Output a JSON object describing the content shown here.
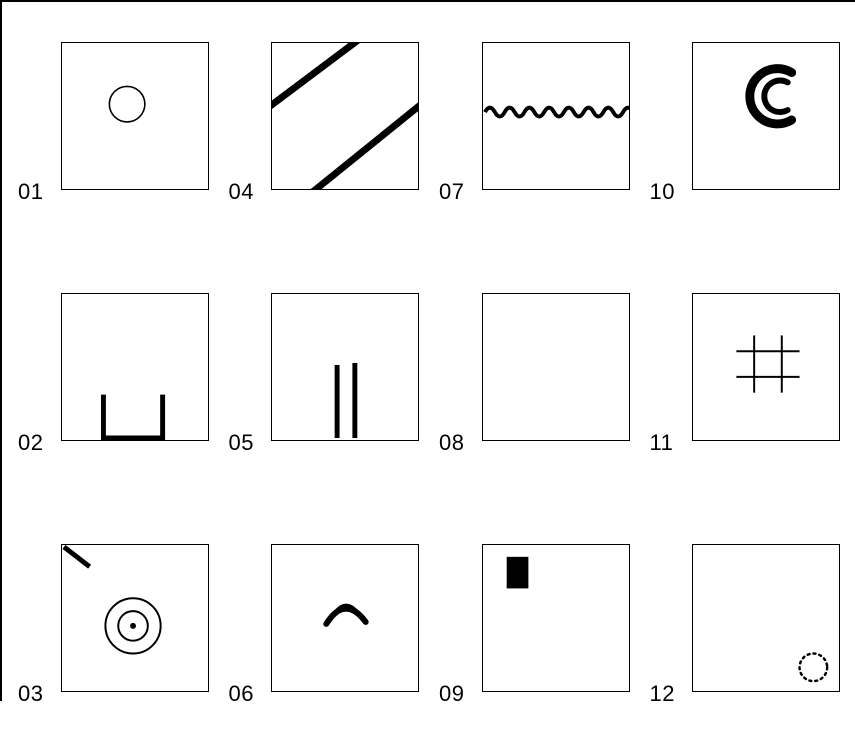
{
  "grid": {
    "rows": 3,
    "cols": 4,
    "cells": [
      {
        "id": "c01",
        "label": "01",
        "shape": "circle",
        "desc": "small hollow circle centered"
      },
      {
        "id": "c04",
        "label": "04",
        "shape": "diagonal-lines",
        "desc": "two thick parallel diagonal lines"
      },
      {
        "id": "c07",
        "label": "07",
        "shape": "zigzag",
        "desc": "horizontal wavy zigzag line"
      },
      {
        "id": "c10",
        "label": "10",
        "shape": "c-double",
        "desc": "thick double-arc capital C"
      },
      {
        "id": "c02",
        "label": "02",
        "shape": "u-square",
        "desc": "partial square open at top, sitting at bottom"
      },
      {
        "id": "c05",
        "label": "05",
        "shape": "two-verticals",
        "desc": "two vertical thick strokes"
      },
      {
        "id": "c08",
        "label": "08",
        "shape": "blank",
        "desc": "empty"
      },
      {
        "id": "c11",
        "label": "11",
        "shape": "hash",
        "desc": "tic-tac-toe grid of thin lines"
      },
      {
        "id": "c03",
        "label": "03",
        "shape": "bullseye-tick",
        "desc": "concentric circles with short tick in top-left corner"
      },
      {
        "id": "c06",
        "label": "06",
        "shape": "crescent",
        "desc": "small filled crescent/arch shape"
      },
      {
        "id": "c09",
        "label": "09",
        "shape": "black-rect",
        "desc": "small solid black rectangle upper-left"
      },
      {
        "id": "c12",
        "label": "12",
        "shape": "dotted-circle",
        "desc": "small dotted circle bottom-right"
      }
    ]
  },
  "shapes": {
    "circle": "<svg viewBox='0 0 148 148'><circle cx='66' cy='62' r='18' fill='none' stroke='#000' stroke-width='1.6'/></svg>",
    "diagonal-lines": "<svg viewBox='0 0 148 148'><line x1='-10' y1='70' x2='110' y2='-20' stroke='#000' stroke-width='7'/><line x1='30' y1='160' x2='160' y2='55' stroke='#000' stroke-width='7'/></svg>",
    "zigzag": "<svg viewBox='0 0 148 148'><path d='M2 70 q5 -9 10 0 q5 9 10 0 q5 -9 10 0 q5 9 10 0 q5 -9 10 0 q5 9 10 0 q5 -9 10 0 q5 9 10 0 q5 -9 10 0 q5 9 10 0 q5 -9 10 0 q5 9 10 0 q5 -9 10 0 q5 9 10 0 q5 -9 10 0' fill='none' stroke='#000' stroke-width='4'/></svg>",
    "c-double": "<svg viewBox='0 0 148 148'><path d='M100 30 A28 28 0 1 0 100 78' fill='none' stroke='#000' stroke-width='9' stroke-linecap='round'/><path d='M96 40 A16 16 0 1 0 96 68' fill='none' stroke='#000' stroke-width='6' stroke-linecap='round'/></svg>",
    "u-square": "<svg viewBox='0 0 148 148'><path d='M42 102 L42 146 L102 146 L102 102' fill='none' stroke='#000' stroke-width='5' stroke-linejoin='miter'/></svg>",
    "two-verticals": "<svg viewBox='0 0 148 148'><line x1='66' y1='72' x2='66' y2='146' stroke='#000' stroke-width='5'/><line x1='84' y1='70' x2='84' y2='146' stroke='#000' stroke-width='5'/></svg>",
    "blank": "<svg viewBox='0 0 148 148'></svg>",
    "hash": "<svg viewBox='0 0 148 148'><line x1='44' y1='58' x2='108' y2='58' stroke='#000' stroke-width='2'/><line x1='44' y1='84' x2='108' y2='84' stroke='#000' stroke-width='2'/><line x1='62' y1='42' x2='62' y2='100' stroke='#000' stroke-width='2'/><line x1='90' y1='42' x2='90' y2='100' stroke='#000' stroke-width='2'/></svg>",
    "bullseye-tick": "<svg viewBox='0 0 148 148'><line x1='2' y1='2' x2='28' y2='22' stroke='#000' stroke-width='5'/><circle cx='72' cy='82' r='28' fill='none' stroke='#000' stroke-width='2'/><circle cx='72' cy='82' r='15' fill='none' stroke='#000' stroke-width='2'/><circle cx='72' cy='82' r='3' fill='#000'/></svg>",
    "crescent": "<svg viewBox='0 0 148 148'><path d='M58 74 Q74 46 92 72 Q76 62 58 74 Z' fill='#000'/><path d='M55 80 Q74 50 95 78' fill='none' stroke='#000' stroke-width='6' stroke-linecap='round'/></svg>",
    "black-rect": "<svg viewBox='0 0 148 148'><rect x='24' y='12' width='22' height='32' fill='#000'/></svg>",
    "dotted-circle": "<svg viewBox='0 0 148 148'><circle cx='122' cy='124' r='14' fill='none' stroke='#000' stroke-width='2.5' stroke-dasharray='2 4' stroke-linecap='round'/></svg>"
  }
}
